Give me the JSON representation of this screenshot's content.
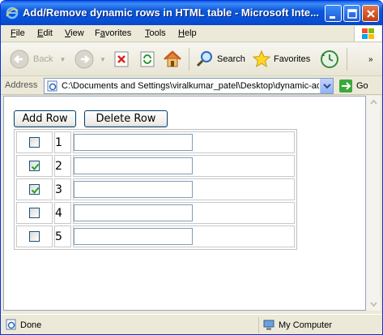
{
  "window": {
    "title": "Add/Remove dynamic rows in HTML table - Microsoft Inte...",
    "buttons": {
      "minimize": "minimize",
      "maximize": "maximize",
      "close": "close"
    }
  },
  "menu": [
    {
      "underline": "F",
      "rest": "ile"
    },
    {
      "underline": "E",
      "rest": "dit"
    },
    {
      "underline": "V",
      "rest": "iew"
    },
    {
      "underline": "",
      "pre": "F",
      "rest": "avorites",
      "u_index": 1
    },
    {
      "underline": "T",
      "rest": "ools"
    },
    {
      "underline": "H",
      "rest": "elp"
    }
  ],
  "toolbar": {
    "back_label": "Back",
    "search_label": "Search",
    "favorites_label": "Favorites"
  },
  "address": {
    "label": "Address",
    "value": "C:\\Documents and Settings\\viralkumar_patel\\Desktop\\dynamic-add",
    "go_label": "Go"
  },
  "page": {
    "add_row_label": "Add Row",
    "delete_row_label": "Delete Row",
    "rows": [
      {
        "checked": false,
        "number": "1",
        "value": ""
      },
      {
        "checked": true,
        "number": "2",
        "value": ""
      },
      {
        "checked": true,
        "number": "3",
        "value": ""
      },
      {
        "checked": false,
        "number": "4",
        "value": ""
      },
      {
        "checked": false,
        "number": "5",
        "value": ""
      }
    ]
  },
  "status": {
    "text": "Done",
    "zone": "My Computer"
  },
  "colors": {
    "titlebar": "#0a5ce6",
    "checkmark": "#21a121",
    "input_border": "#7f9db9"
  }
}
